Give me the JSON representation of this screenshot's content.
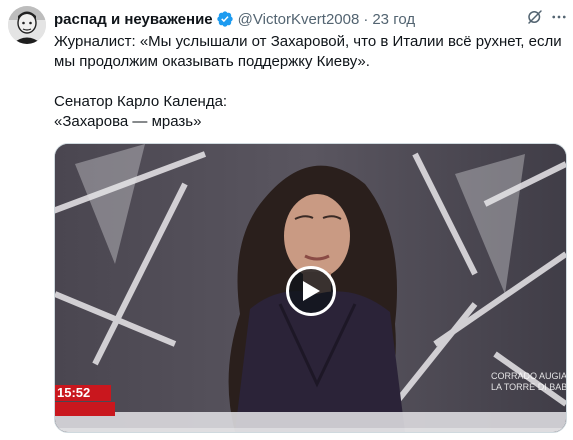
{
  "author": {
    "name": "распад и неуважение",
    "handle": "@VictorKvert2008",
    "separator": "·",
    "time": "23 год",
    "verified": true
  },
  "icons": {
    "avatar": "avatar-image",
    "verified": "verified-badge-icon",
    "grok": "grok-icon",
    "more": "more-options-icon",
    "play": "play-icon"
  },
  "tweet": {
    "lines": [
      "Журналист: «Мы услышали от Захаровой, что в Италии всё рухнет, если мы продолжим оказывать поддержку Киеву».",
      "Сенатор Карло Календа:",
      "«Захарова — мразь»"
    ]
  },
  "video": {
    "clock": "15:52",
    "ticker_lines": [
      "CORRADO AUGIAS",
      "LA TORRE DI BABELE"
    ],
    "progress": 0.0
  },
  "colors": {
    "accent": "#1d9bf0",
    "text": "#0f1419",
    "secondary": "#536471",
    "ticker_red": "#c9171e"
  }
}
